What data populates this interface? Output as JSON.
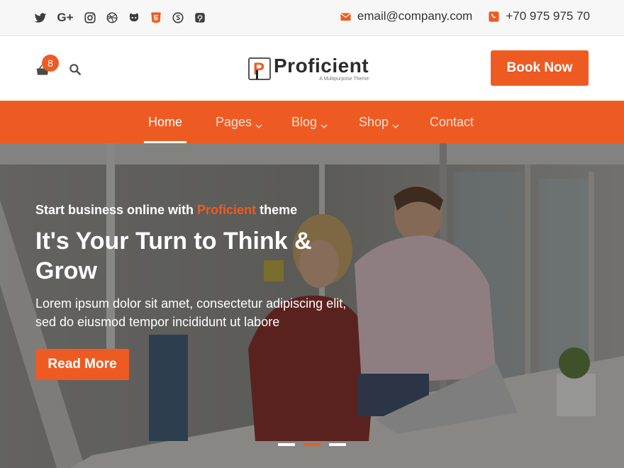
{
  "topbar": {
    "social": [
      {
        "icon": "twitter-icon"
      },
      {
        "icon": "google-plus-icon",
        "text": "G+"
      },
      {
        "icon": "instagram-icon"
      },
      {
        "icon": "dribbble-icon"
      },
      {
        "icon": "github-icon"
      },
      {
        "icon": "html5-icon"
      },
      {
        "icon": "skype-icon"
      },
      {
        "icon": "pinterest-icon"
      }
    ],
    "email": "email@company.com",
    "phone": "+70 975 975 70"
  },
  "header": {
    "cart_count": "8",
    "logo_letter": "P",
    "logo_name": "Proficient",
    "logo_tagline": "A Multipurpose Theme",
    "book_button": "Book Now"
  },
  "nav": {
    "items": [
      {
        "label": "Home",
        "active": true
      },
      {
        "label": "Pages",
        "dropdown": true
      },
      {
        "label": "Blog",
        "dropdown": true
      },
      {
        "label": "Shop",
        "dropdown": true
      },
      {
        "label": "Contact"
      }
    ]
  },
  "hero": {
    "subtitle_prefix": "Start business online with",
    "subtitle_highlight": "Proficient",
    "subtitle_suffix": "theme",
    "title": "It's Your Turn to Think & Grow",
    "text": "Lorem ipsum dolor sit amet, consectetur adipiscing elit, sed do eiusmod tempor incididunt ut labore",
    "button": "Read More",
    "slides": 3,
    "active_slide": 2
  },
  "colors": {
    "accent": "#ee5b22",
    "topbar_bg": "#f7f7f7",
    "text_dark": "#333333"
  }
}
